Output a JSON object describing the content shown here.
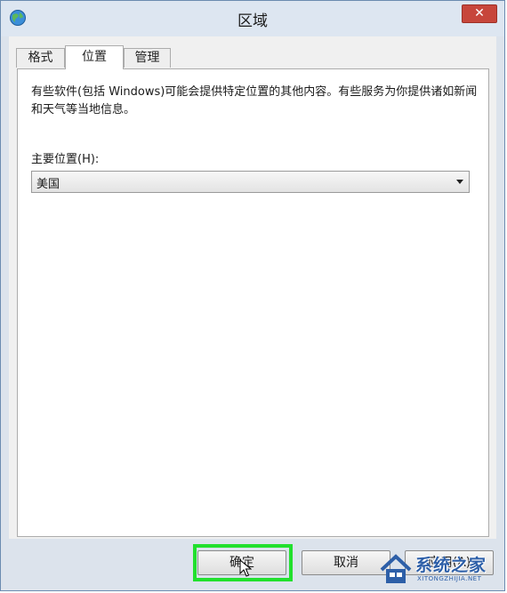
{
  "window": {
    "title": "区域",
    "close_symbol": "✕"
  },
  "tabs": [
    {
      "label": "格式",
      "active": false
    },
    {
      "label": "位置",
      "active": true
    },
    {
      "label": "管理",
      "active": false
    }
  ],
  "location_panel": {
    "description": "有些软件(包括 Windows)可能会提供特定位置的其他内容。有些服务为你提供诸如新闻和天气等当地信息。",
    "home_location_label": "主要位置(H):",
    "home_location_value": "美国"
  },
  "buttons": {
    "ok_label": "确定",
    "cancel_label": "取消",
    "apply_label": "应用(A)"
  },
  "watermark": {
    "brand": "系统之家",
    "url": "XITONGZHIJIA.NET"
  },
  "colors": {
    "highlight": "#22e02e",
    "close_button": "#c7463b",
    "watermark": "#2d5fa8"
  },
  "icons": {
    "title_icon": "globe-icon",
    "close_icon": "close-icon",
    "dropdown_icon": "chevron-down-icon",
    "cursor_icon": "mouse-pointer-icon",
    "watermark_logo": "house-logo-icon"
  }
}
